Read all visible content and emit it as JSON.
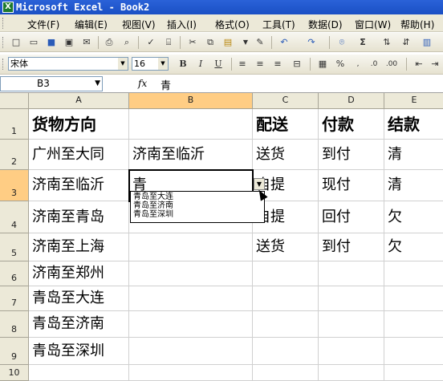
{
  "window": {
    "title": "Microsoft Excel - Book2"
  },
  "menu": [
    "文件(F)",
    "编辑(E)",
    "视图(V)",
    "插入(I)",
    "格式(O)",
    "工具(T)",
    "数据(D)",
    "窗口(W)",
    "帮助(H)"
  ],
  "format_toolbar": {
    "font_name": "宋体",
    "font_size": "16",
    "bold": "B",
    "italic": "I",
    "underline": "U"
  },
  "formula_bar": {
    "name_box": "B3",
    "fx": "fx",
    "content": "青"
  },
  "columns": [
    "A",
    "B",
    "C",
    "D",
    "E"
  ],
  "rows": [
    "1",
    "2",
    "3",
    "4",
    "5",
    "6",
    "7",
    "8",
    "9",
    "10"
  ],
  "cells": {
    "A1": "货物方向",
    "C1": "配送",
    "D1": "付款",
    "E1": "结款",
    "A2": "广州至大同",
    "B2": "济南至临沂",
    "C2": "送货",
    "D2": "到付",
    "E2": "清",
    "A3": "济南至临沂",
    "B3": "青",
    "C3": "自提",
    "D3": "现付",
    "E3": "清",
    "A4": "济南至青岛",
    "C4": "自提",
    "D4": "回付",
    "E4": "欠",
    "A5": "济南至上海",
    "C5": "送货",
    "D5": "到付",
    "E5": "欠",
    "A6": "济南至郑州",
    "A7": "青岛至大连",
    "A8": "青岛至济南",
    "A9": "青岛至深圳"
  },
  "validation_list": [
    "青岛至大连",
    "青岛至济南",
    "青岛至深圳"
  ]
}
